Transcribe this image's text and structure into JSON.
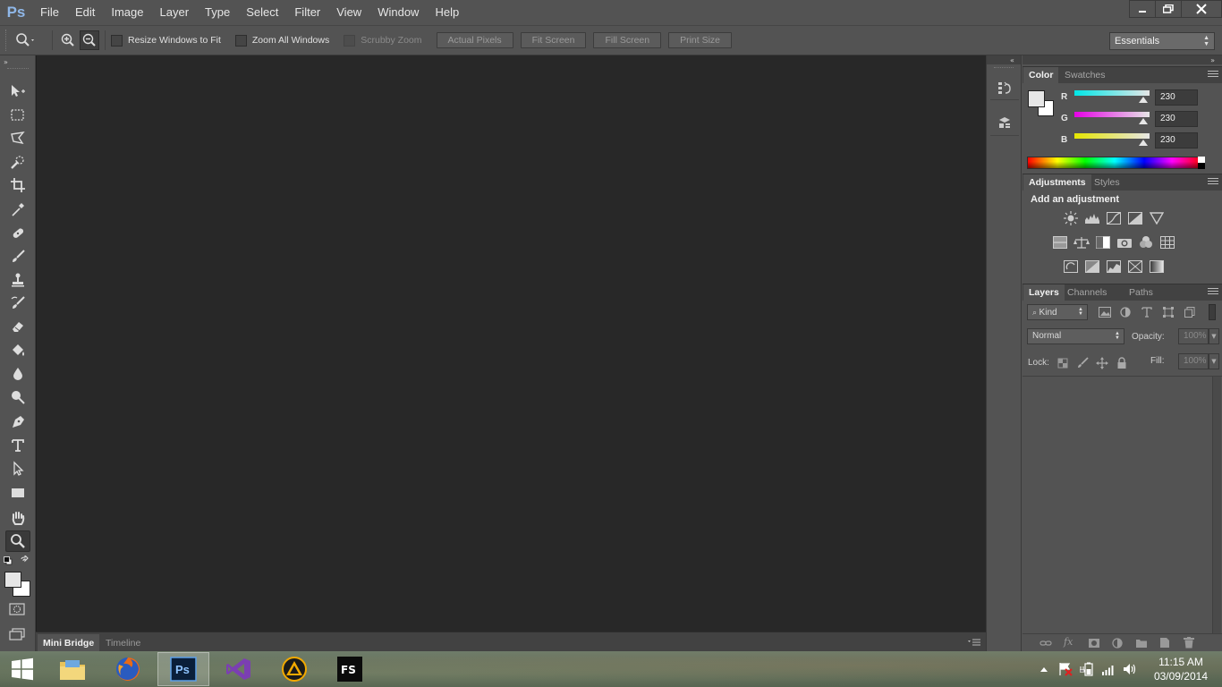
{
  "app": {
    "logo": "Ps"
  },
  "menu": [
    "File",
    "Edit",
    "Image",
    "Layer",
    "Type",
    "Select",
    "Filter",
    "View",
    "Window",
    "Help"
  ],
  "options": {
    "resize_windows": "Resize Windows to Fit",
    "zoom_all": "Zoom All Windows",
    "scrubby_zoom": "Scrubby Zoom",
    "actual_pixels": "Actual Pixels",
    "fit_screen": "Fit Screen",
    "fill_screen": "Fill Screen",
    "print_size": "Print Size",
    "workspace": "Essentials"
  },
  "bottom_panel": {
    "tabs": [
      "Mini Bridge",
      "Timeline"
    ]
  },
  "color_panel": {
    "tabs": [
      "Color",
      "Swatches"
    ],
    "channels": [
      {
        "label": "R",
        "value": "230",
        "color": "#00d7e6"
      },
      {
        "label": "G",
        "value": "230",
        "color": "#e000e6"
      },
      {
        "label": "B",
        "value": "230",
        "color": "#e6e600"
      }
    ]
  },
  "adjustments_panel": {
    "tabs": [
      "Adjustments",
      "Styles"
    ],
    "heading": "Add an adjustment"
  },
  "layers_panel": {
    "tabs": [
      "Layers",
      "Channels",
      "Paths"
    ],
    "filter_kind": "Kind",
    "blend_mode": "Normal",
    "opacity_label": "Opacity:",
    "opacity_value": "100%",
    "lock_label": "Lock:",
    "fill_label": "Fill:",
    "fill_value": "100%"
  },
  "taskbar": {
    "time": "11:15 AM",
    "date": "03/09/2014",
    "apps": [
      "file-explorer",
      "firefox",
      "photoshop",
      "visual-studio",
      "ableton-like",
      "fs-app"
    ]
  },
  "icon_names": {
    "tools": [
      "move-tool-icon",
      "marquee-tool-icon",
      "lasso-tool-icon",
      "quick-selection-tool-icon",
      "crop-tool-icon",
      "eyedropper-tool-icon",
      "spot-healing-tool-icon",
      "brush-tool-icon",
      "clone-stamp-tool-icon",
      "history-brush-tool-icon",
      "eraser-tool-icon",
      "paint-bucket-tool-icon",
      "blur-tool-icon",
      "dodge-tool-icon",
      "pen-tool-icon",
      "type-tool-icon",
      "path-selection-tool-icon",
      "rectangle-tool-icon",
      "hand-tool-icon",
      "zoom-tool-icon"
    ]
  }
}
